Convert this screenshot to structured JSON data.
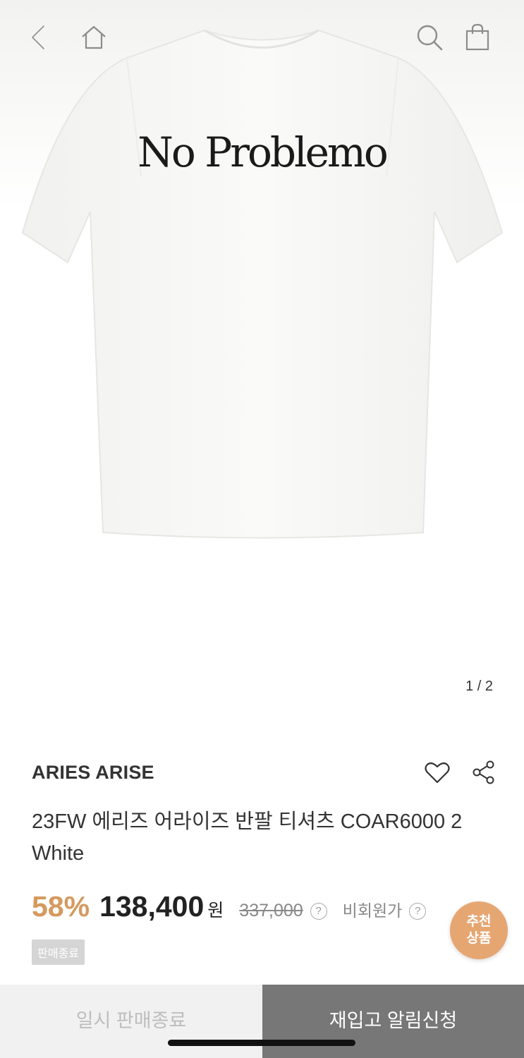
{
  "hero": {
    "print_text": "No Problemo",
    "pager": "1 / 2",
    "icons": [
      "back-icon",
      "home-icon",
      "search-icon",
      "shopping-bag-icon"
    ]
  },
  "product": {
    "brand": "ARIES ARISE",
    "title": "23FW 에리즈 어라이즈 반팔 티셔츠 COAR6000 2 White",
    "discount": "58%",
    "price": "138,400",
    "currency": "원",
    "original_price": "337,000",
    "help_mark": "?",
    "member_price_label": "비회원가",
    "status_badge": "판매종료",
    "icons": [
      "heart-icon",
      "share-icon"
    ]
  },
  "recommend": {
    "line1": "추천",
    "line2": "상품"
  },
  "bottom_bar": {
    "left_label": "일시 판매종료",
    "right_label": "재입고 알림신청"
  },
  "colors": {
    "discount": "#d49a5f",
    "recommend_bg": "#e6a672",
    "notify_bg": "#777777",
    "soldout_bg": "#f1f1f1"
  }
}
